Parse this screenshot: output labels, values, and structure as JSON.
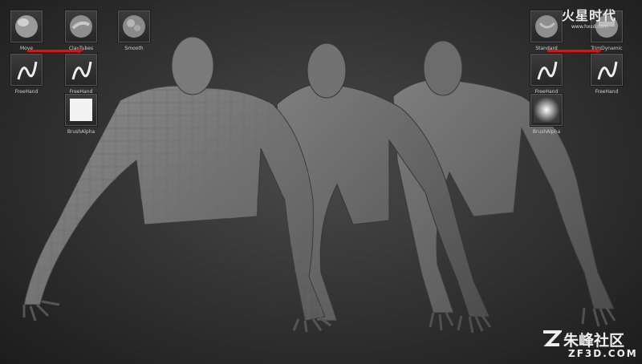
{
  "brushes_left": {
    "row1": [
      "Move",
      "ClayTubes",
      "Smooth"
    ],
    "row2": [
      "FreeHand",
      "FreeHand"
    ],
    "row3": [
      "BrushAlpha"
    ]
  },
  "brushes_right": {
    "row1": [
      "Standard",
      "TrimDynamic"
    ],
    "row2": [
      "FreeHand",
      "FreeHand"
    ],
    "row3": [
      "BrushAlpha"
    ]
  },
  "watermark_top": {
    "text_cn": "火星时代",
    "url": "www.hxsd.com"
  },
  "watermark_bottom": {
    "text_cn": "朱峰社区",
    "url": "ZF3D.COM"
  },
  "colors": {
    "arrow": "#c0201e",
    "background": "#353535",
    "clay": "#7a7a7a"
  },
  "icons": [
    "move-brush-icon",
    "claytubes-brush-icon",
    "smooth-brush-icon",
    "freehand-stroke-icon",
    "brush-alpha-icon",
    "standard-brush-icon",
    "trimdynamic-brush-icon"
  ]
}
